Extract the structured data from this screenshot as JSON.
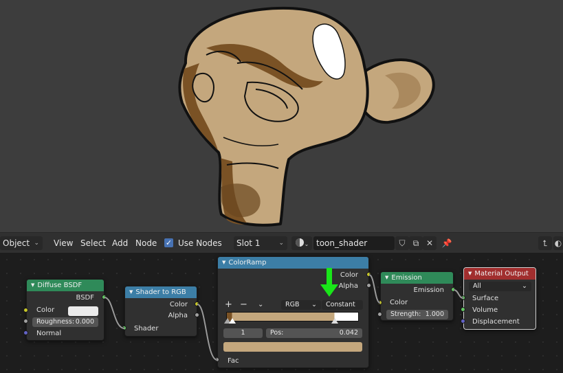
{
  "header": {
    "mode": "Object",
    "menu": [
      "View",
      "Select",
      "Add",
      "Node"
    ],
    "use_nodes_label": "Use Nodes",
    "use_nodes_checked": true,
    "slot": "Slot 1",
    "material_name": "toon_shader"
  },
  "nodes": {
    "diffuse": {
      "title": "Diffuse BSDF",
      "output": "BSDF",
      "color_label": "Color",
      "roughness_label": "Roughness:",
      "roughness_value": "0.000",
      "normal_label": "Normal"
    },
    "shader_to_rgb": {
      "title": "Shader to RGB",
      "color_label": "Color",
      "alpha_label": "Alpha",
      "shader_label": "Shader"
    },
    "colorramp": {
      "title": "ColorRamp",
      "color_label": "Color",
      "alpha_label": "Alpha",
      "add_symbol": "+",
      "remove_symbol": "−",
      "color_mode": "RGB",
      "interpolation": "Constant",
      "stop_index": "1",
      "pos_label": "Pos:",
      "pos_value": "0.042",
      "fac_label": "Fac",
      "stop_color": "#c4a77d"
    },
    "emission": {
      "title": "Emission",
      "output": "Emission",
      "color_label": "Color",
      "strength_label": "Strength:",
      "strength_value": "1.000"
    },
    "output": {
      "title": "Material Output",
      "target": "All",
      "surface_label": "Surface",
      "volume_label": "Volume",
      "displacement_label": "Displacement"
    }
  },
  "colors": {
    "shader_header": "#2f8a59",
    "converter_header": "#3c7ea6",
    "output_header": "#a12e2e",
    "toon_base": "#c4a77d",
    "toon_shadow": "#7a5225",
    "annotation_arrow": "#19e619"
  }
}
